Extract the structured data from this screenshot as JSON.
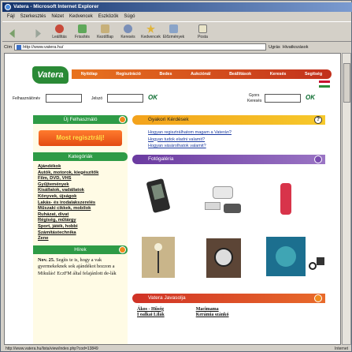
{
  "window": {
    "title": "Vatera - Microsoft Internet Explorer",
    "menu": [
      "Fájl",
      "Szerkesztés",
      "Nézet",
      "Kedvencek",
      "Eszközök",
      "Súgó"
    ],
    "toolbar": [
      "",
      "",
      "Leállítás",
      "Frissítés",
      "Kezdőlap",
      "Keresés",
      "Kedvencek",
      "Előzmények",
      "",
      "Posta"
    ],
    "address_label": "Cím",
    "address": "http://www.vatera.hu/",
    "go": "Ugrás",
    "links": "Hivatkozások",
    "status_url": "http://www.vatera.hu/lista/view/index.php?cod=13849",
    "status_zone": "Internet"
  },
  "site": {
    "logo": "Vatera",
    "nav": [
      "Nyitólap",
      "Regisztráció",
      "Bedes",
      "Aukciónál",
      "Beállítások",
      "Keresés",
      "Segítség"
    ],
    "flag_colors": [
      "#c8102e",
      "#ffffff",
      "#2e8b3a"
    ],
    "login": {
      "user_label": "Felhasználónév",
      "pass_label": "Jelszó",
      "search_label_1": "Gyors",
      "search_label_2": "Keresés",
      "ok": "OK"
    },
    "new_user": {
      "heading": "Új Felhasználó",
      "button": "Most regisztrálj!"
    },
    "categories": {
      "heading": "Kategóriák",
      "items": [
        "Ajándékok",
        "Autók, motorok, kiegészítők",
        "Film, DVD, VHS",
        "Gyűjtemények",
        "Kisállatok, vadállatok",
        "Könyvek, újságok",
        "Lakás- és irodalakszerelés",
        "Műszaki cikkek, mobilok",
        "Ruházat, divat",
        "Régiség, műtárgy",
        "Sport, játék, hobbi",
        "Számítástechnika",
        "Zene"
      ]
    },
    "news": {
      "heading": "Hírek",
      "date": "Nov. 25.",
      "text": "Segíts te is, hogy a vak gyermekeknek sok ajándékot hozzon a Mikulás! EczFM által felajánlott de-lák"
    },
    "faq": {
      "heading": "Gyakori Kérdések",
      "items": [
        "Hogyan regisztrálhatom magam a Vaterán?",
        "Hogyan tudok eladni valamit?",
        "Hogyan vásárolhatok valamit?"
      ]
    },
    "gallery": {
      "heading": "Fotógaléria"
    },
    "recommend": {
      "heading": "Vatera Javasolja",
      "items": [
        [
          "Ákos - Hűség",
          "I oalkai Lilák"
        ],
        [
          "Macimama",
          "Kerámia szánkó"
        ]
      ]
    }
  }
}
